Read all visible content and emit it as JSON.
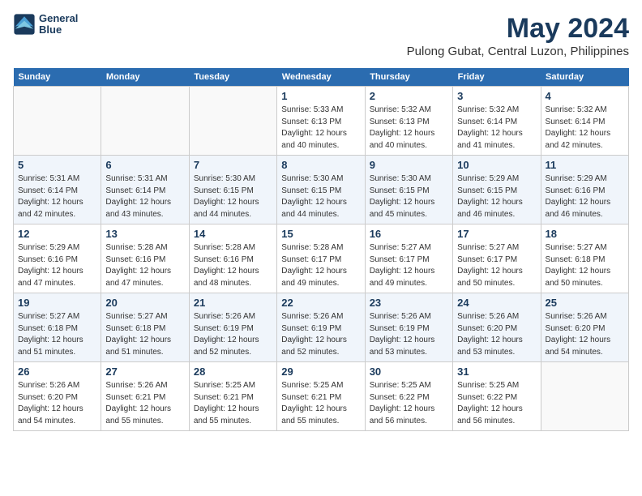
{
  "logo": {
    "line1": "General",
    "line2": "Blue"
  },
  "title": "May 2024",
  "subtitle": "Pulong Gubat, Central Luzon, Philippines",
  "days": [
    "Sunday",
    "Monday",
    "Tuesday",
    "Wednesday",
    "Thursday",
    "Friday",
    "Saturday"
  ],
  "weeks": [
    [
      {
        "num": "",
        "content": ""
      },
      {
        "num": "",
        "content": ""
      },
      {
        "num": "",
        "content": ""
      },
      {
        "num": "1",
        "content": "Sunrise: 5:33 AM\nSunset: 6:13 PM\nDaylight: 12 hours\nand 40 minutes."
      },
      {
        "num": "2",
        "content": "Sunrise: 5:32 AM\nSunset: 6:13 PM\nDaylight: 12 hours\nand 40 minutes."
      },
      {
        "num": "3",
        "content": "Sunrise: 5:32 AM\nSunset: 6:14 PM\nDaylight: 12 hours\nand 41 minutes."
      },
      {
        "num": "4",
        "content": "Sunrise: 5:32 AM\nSunset: 6:14 PM\nDaylight: 12 hours\nand 42 minutes."
      }
    ],
    [
      {
        "num": "5",
        "content": "Sunrise: 5:31 AM\nSunset: 6:14 PM\nDaylight: 12 hours\nand 42 minutes."
      },
      {
        "num": "6",
        "content": "Sunrise: 5:31 AM\nSunset: 6:14 PM\nDaylight: 12 hours\nand 43 minutes."
      },
      {
        "num": "7",
        "content": "Sunrise: 5:30 AM\nSunset: 6:15 PM\nDaylight: 12 hours\nand 44 minutes."
      },
      {
        "num": "8",
        "content": "Sunrise: 5:30 AM\nSunset: 6:15 PM\nDaylight: 12 hours\nand 44 minutes."
      },
      {
        "num": "9",
        "content": "Sunrise: 5:30 AM\nSunset: 6:15 PM\nDaylight: 12 hours\nand 45 minutes."
      },
      {
        "num": "10",
        "content": "Sunrise: 5:29 AM\nSunset: 6:15 PM\nDaylight: 12 hours\nand 46 minutes."
      },
      {
        "num": "11",
        "content": "Sunrise: 5:29 AM\nSunset: 6:16 PM\nDaylight: 12 hours\nand 46 minutes."
      }
    ],
    [
      {
        "num": "12",
        "content": "Sunrise: 5:29 AM\nSunset: 6:16 PM\nDaylight: 12 hours\nand 47 minutes."
      },
      {
        "num": "13",
        "content": "Sunrise: 5:28 AM\nSunset: 6:16 PM\nDaylight: 12 hours\nand 47 minutes."
      },
      {
        "num": "14",
        "content": "Sunrise: 5:28 AM\nSunset: 6:16 PM\nDaylight: 12 hours\nand 48 minutes."
      },
      {
        "num": "15",
        "content": "Sunrise: 5:28 AM\nSunset: 6:17 PM\nDaylight: 12 hours\nand 49 minutes."
      },
      {
        "num": "16",
        "content": "Sunrise: 5:27 AM\nSunset: 6:17 PM\nDaylight: 12 hours\nand 49 minutes."
      },
      {
        "num": "17",
        "content": "Sunrise: 5:27 AM\nSunset: 6:17 PM\nDaylight: 12 hours\nand 50 minutes."
      },
      {
        "num": "18",
        "content": "Sunrise: 5:27 AM\nSunset: 6:18 PM\nDaylight: 12 hours\nand 50 minutes."
      }
    ],
    [
      {
        "num": "19",
        "content": "Sunrise: 5:27 AM\nSunset: 6:18 PM\nDaylight: 12 hours\nand 51 minutes."
      },
      {
        "num": "20",
        "content": "Sunrise: 5:27 AM\nSunset: 6:18 PM\nDaylight: 12 hours\nand 51 minutes."
      },
      {
        "num": "21",
        "content": "Sunrise: 5:26 AM\nSunset: 6:19 PM\nDaylight: 12 hours\nand 52 minutes."
      },
      {
        "num": "22",
        "content": "Sunrise: 5:26 AM\nSunset: 6:19 PM\nDaylight: 12 hours\nand 52 minutes."
      },
      {
        "num": "23",
        "content": "Sunrise: 5:26 AM\nSunset: 6:19 PM\nDaylight: 12 hours\nand 53 minutes."
      },
      {
        "num": "24",
        "content": "Sunrise: 5:26 AM\nSunset: 6:20 PM\nDaylight: 12 hours\nand 53 minutes."
      },
      {
        "num": "25",
        "content": "Sunrise: 5:26 AM\nSunset: 6:20 PM\nDaylight: 12 hours\nand 54 minutes."
      }
    ],
    [
      {
        "num": "26",
        "content": "Sunrise: 5:26 AM\nSunset: 6:20 PM\nDaylight: 12 hours\nand 54 minutes."
      },
      {
        "num": "27",
        "content": "Sunrise: 5:26 AM\nSunset: 6:21 PM\nDaylight: 12 hours\nand 55 minutes."
      },
      {
        "num": "28",
        "content": "Sunrise: 5:25 AM\nSunset: 6:21 PM\nDaylight: 12 hours\nand 55 minutes."
      },
      {
        "num": "29",
        "content": "Sunrise: 5:25 AM\nSunset: 6:21 PM\nDaylight: 12 hours\nand 55 minutes."
      },
      {
        "num": "30",
        "content": "Sunrise: 5:25 AM\nSunset: 6:22 PM\nDaylight: 12 hours\nand 56 minutes."
      },
      {
        "num": "31",
        "content": "Sunrise: 5:25 AM\nSunset: 6:22 PM\nDaylight: 12 hours\nand 56 minutes."
      },
      {
        "num": "",
        "content": ""
      }
    ]
  ]
}
